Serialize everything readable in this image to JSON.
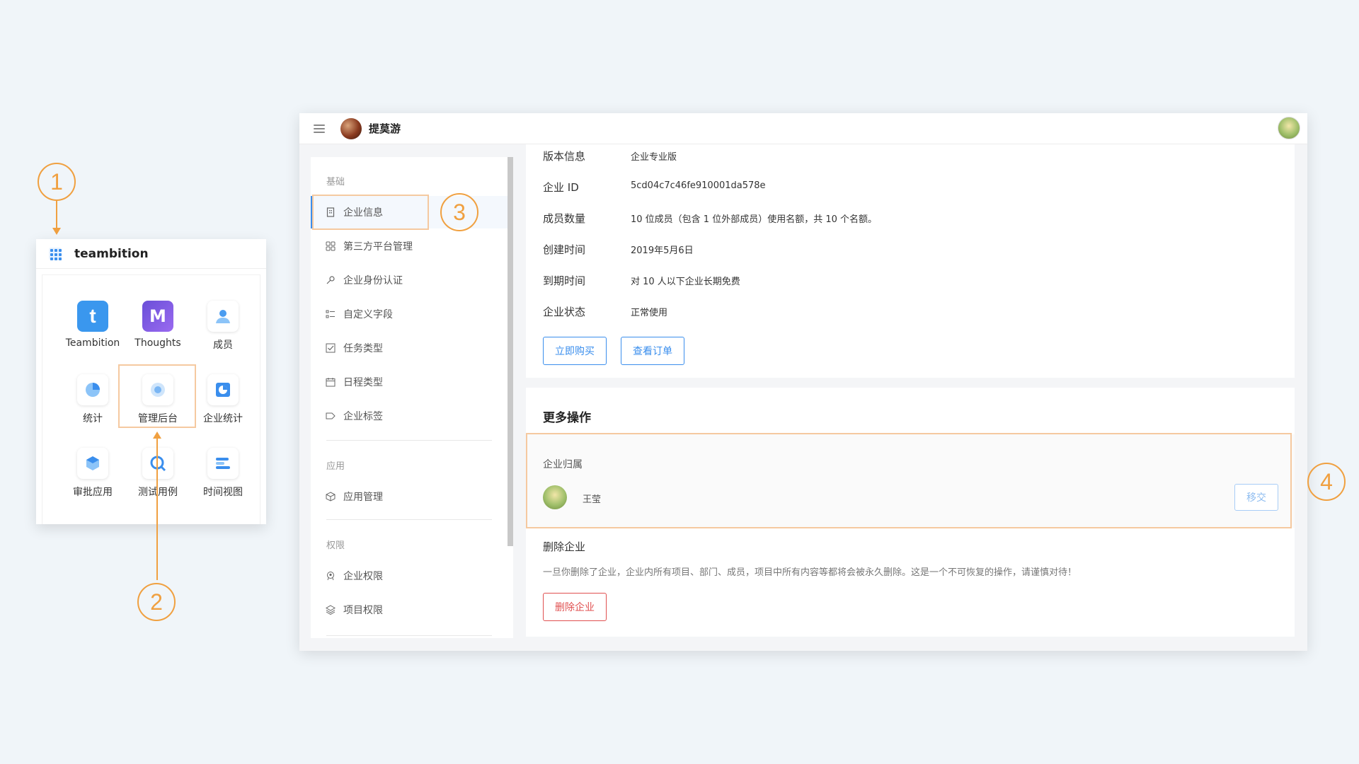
{
  "annotations": {
    "m1": "1",
    "m2": "2",
    "m3": "3",
    "m4": "4"
  },
  "switcher": {
    "title": "teambition",
    "apps": [
      {
        "label": "Teambition",
        "icon": "teambition-logo-icon"
      },
      {
        "label": "Thoughts",
        "icon": "thoughts-logo-icon"
      },
      {
        "label": "成员",
        "icon": "members-icon"
      },
      {
        "label": "统计",
        "icon": "pie-chart-icon"
      },
      {
        "label": "管理后台",
        "icon": "admin-icon"
      },
      {
        "label": "企业统计",
        "icon": "enterprise-stats-icon"
      },
      {
        "label": "审批应用",
        "icon": "cube-icon"
      },
      {
        "label": "测试用例",
        "icon": "test-case-icon"
      },
      {
        "label": "时间视图",
        "icon": "timeline-icon"
      }
    ]
  },
  "topbar": {
    "org_name": "提莫游"
  },
  "sidebar": {
    "sections": {
      "basic": "基础",
      "apps": "应用",
      "permissions": "权限"
    },
    "items": [
      {
        "label": "企业信息",
        "icon": "building-icon"
      },
      {
        "label": "第三方平台管理",
        "icon": "grid-icon"
      },
      {
        "label": "企业身份认证",
        "icon": "key-icon"
      },
      {
        "label": "自定义字段",
        "icon": "list-icon"
      },
      {
        "label": "任务类型",
        "icon": "checkbox-icon"
      },
      {
        "label": "日程类型",
        "icon": "calendar-icon"
      },
      {
        "label": "企业标签",
        "icon": "tag-icon"
      },
      {
        "label": "应用管理",
        "icon": "cube-icon"
      },
      {
        "label": "企业权限",
        "icon": "shield-user-icon"
      },
      {
        "label": "项目权限",
        "icon": "layers-icon"
      }
    ]
  },
  "info": {
    "rows": [
      {
        "key": "版本信息",
        "value": "企业专业版"
      },
      {
        "key": "企业 ID",
        "value": "5cd04c7c46fe910001da578e"
      },
      {
        "key": "成员数量",
        "value": "10 位成员（包含 1 位外部成员）使用名额，共 10 个名额。"
      },
      {
        "key": "创建时间",
        "value": "2019年5月6日"
      },
      {
        "key": "到期时间",
        "value": "对 10 人以下企业长期免费"
      },
      {
        "key": "企业状态",
        "value": "正常使用"
      }
    ],
    "buy_button": "立即购买",
    "orders_button": "查看订单"
  },
  "more": {
    "title": "更多操作",
    "owner_label": "企业归属",
    "owner_name": "王莹",
    "transfer_button": "移交",
    "delete_title": "删除企业",
    "delete_desc": "一旦你删除了企业，企业内所有项目、部门、成员，项目中所有内容等都将会被永久删除。这是一个不可恢复的操作，请谨慎对待！",
    "delete_button": "删除企业"
  },
  "colors": {
    "accent": "#3a8eed",
    "annotation": "#f0a040",
    "danger": "#e05050"
  }
}
